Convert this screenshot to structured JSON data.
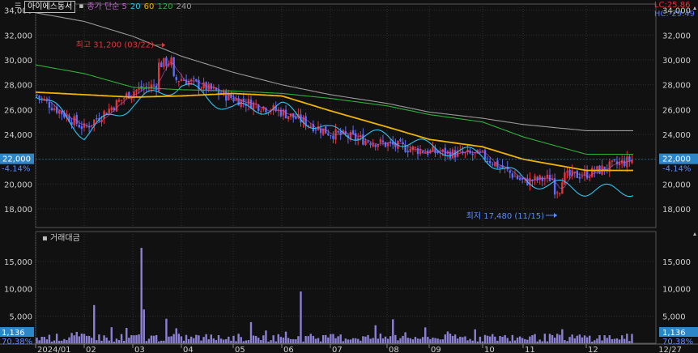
{
  "header": {
    "menu_icon": "menu-icon",
    "stock_name": "아이에스동서",
    "price_label": "종가 단순 5",
    "ma": [
      {
        "label": "20",
        "color": "#2ec4f2"
      },
      {
        "label": "60",
        "color": "#f0b400"
      },
      {
        "label": "120",
        "color": "#2fae3a"
      },
      {
        "label": "240",
        "color": "#9a9a9a"
      }
    ],
    "lc": "LC:25.86",
    "hc": "HC:-29.49"
  },
  "colors": {
    "up": "#e8323a",
    "down": "#5a6cff",
    "ma5": "#c060d0",
    "ma20": "#2ec4f2",
    "ma60": "#f0b400",
    "ma120": "#2fae3a",
    "ma240": "#9a9a9a",
    "volume": "#8c80d6",
    "current_box": "#2d86c8"
  },
  "price_axis": {
    "min": 16500,
    "max": 34500,
    "ticks": [
      "34,000",
      "32,000",
      "30,000",
      "28,000",
      "26,000",
      "24,000",
      "22,000",
      "20,000",
      "18,000"
    ],
    "current_price": "22,000",
    "current_change": "-4.14%"
  },
  "volume_axis": {
    "label": "거래대금",
    "max": 19000,
    "ticks": [
      "15,000",
      "10,000",
      "5,000"
    ],
    "current_value": "1,136",
    "current_pct": "70.38%"
  },
  "annotations": {
    "high": "최고 31,200 (03/22)",
    "low": "최저 17,480 (11/15)"
  },
  "x_axis": [
    "2024/01",
    "02",
    "03",
    "04",
    "05",
    "06",
    "07",
    "08",
    "09",
    "10",
    "11",
    "12",
    "12/27"
  ],
  "chart_data": {
    "type": "candlestick",
    "title": "",
    "months": [
      "2024/01",
      "02",
      "03",
      "04",
      "05",
      "06",
      "07",
      "08",
      "09",
      "10",
      "11",
      "12"
    ],
    "high": {
      "value": 31200,
      "date": "03/22"
    },
    "low": {
      "value": 17480,
      "date": "11/15"
    },
    "close_by_month_start": [
      27200,
      24500,
      27500,
      28500,
      26900,
      25800,
      24100,
      23200,
      22600,
      22300,
      20200,
      20800
    ],
    "current_close": 22000,
    "change_pct": -4.14,
    "ma_series": [
      {
        "name": "20",
        "values_by_month_start": [
          27500,
          24000,
          26500,
          28000,
          26000,
          26200,
          24200,
          23800,
          23000,
          22300,
          20300,
          19500
        ]
      },
      {
        "name": "60",
        "values_by_month_start": [
          27400,
          27200,
          27000,
          27100,
          27300,
          27100,
          25900,
          24600,
          23600,
          23000,
          22000,
          21100
        ]
      },
      {
        "name": "120",
        "values_by_month_start": [
          29600,
          28900,
          27800,
          27600,
          27500,
          27300,
          26900,
          26300,
          25600,
          25000,
          23800,
          22400
        ]
      },
      {
        "name": "240",
        "values_by_month_start": [
          33800,
          33100,
          31900,
          30300,
          29000,
          28000,
          27200,
          26500,
          25800,
          25300,
          24800,
          24300
        ]
      }
    ],
    "volume_peaks": [
      {
        "month": "03",
        "value": 17500
      },
      {
        "month": "06",
        "value": 9500
      },
      {
        "month": "01",
        "value": 7000
      }
    ]
  }
}
